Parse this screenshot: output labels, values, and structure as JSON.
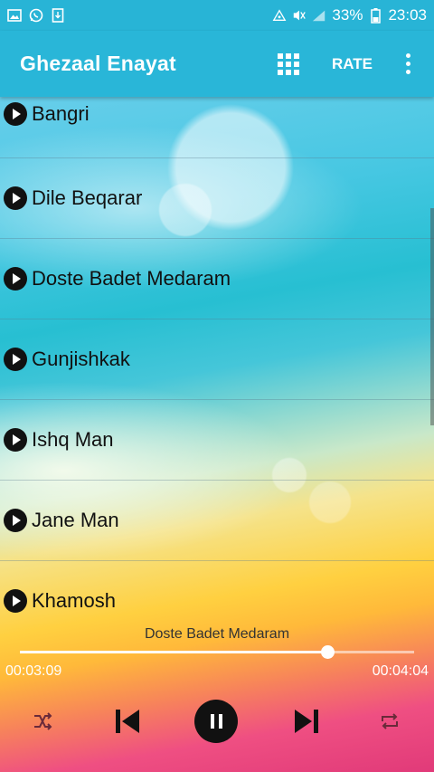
{
  "status_bar": {
    "battery": "33%",
    "time": "23:03"
  },
  "app_bar": {
    "title": "Ghezaal Enayat",
    "rate_label": "RATE"
  },
  "songs": [
    "Bangri",
    "Dile Beqarar",
    "Doste Badet Medaram",
    "Gunjishkak",
    "Ishq Man",
    "Jane Man",
    "Khamosh"
  ],
  "player": {
    "now_playing": "Doste Badet Medaram",
    "elapsed": "00:03:09",
    "duration": "00:04:04",
    "progress": 0.78
  },
  "colors": {
    "accent": "#29b6d8"
  }
}
